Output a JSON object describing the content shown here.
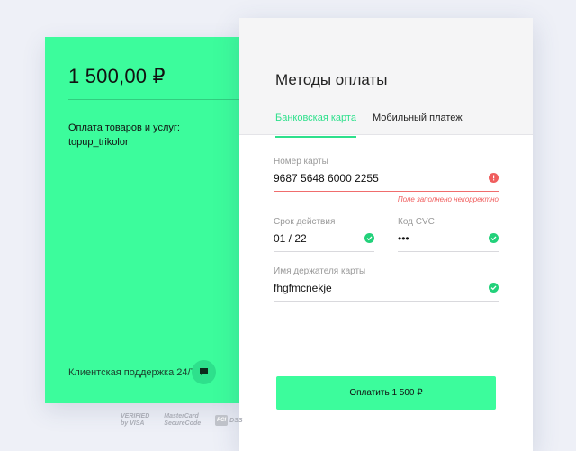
{
  "summary": {
    "amount": "1 500,00 ₽",
    "description_line1": "Оплата товаров и услуг:",
    "description_line2": "topup_trikolor",
    "support_label": "Клиентская поддержка 24/7",
    "chat_icon": "chat-bubble-icon"
  },
  "payment": {
    "title": "Методы оплаты",
    "tabs": [
      {
        "label": "Банковская карта",
        "active": true
      },
      {
        "label": "Мобильный платеж",
        "active": false
      }
    ],
    "card_number": {
      "label": "Номер карты",
      "value": "9687 5648 6000 2255",
      "error": "Поле заполнено некорректно"
    },
    "expiry": {
      "label": "Срок действия",
      "value": "01 / 22"
    },
    "cvc": {
      "label": "Код CVC",
      "value": "•••"
    },
    "holder": {
      "label": "Имя держателя карты",
      "value": "fhgfmcnekje"
    },
    "pay_button": "Оплатить 1 500 ₽"
  },
  "security_logos": {
    "visa_line1": "VERIFIED",
    "visa_line2": "by VISA",
    "mc_line1": "MasterCard",
    "mc_line2": "SecureCode",
    "pci_badge": "PCI",
    "pci_text": "DSS"
  },
  "colors": {
    "accent": "#3cfc9c",
    "success": "#22d17a",
    "error": "#f05e5e",
    "background": "#eef0f7"
  }
}
